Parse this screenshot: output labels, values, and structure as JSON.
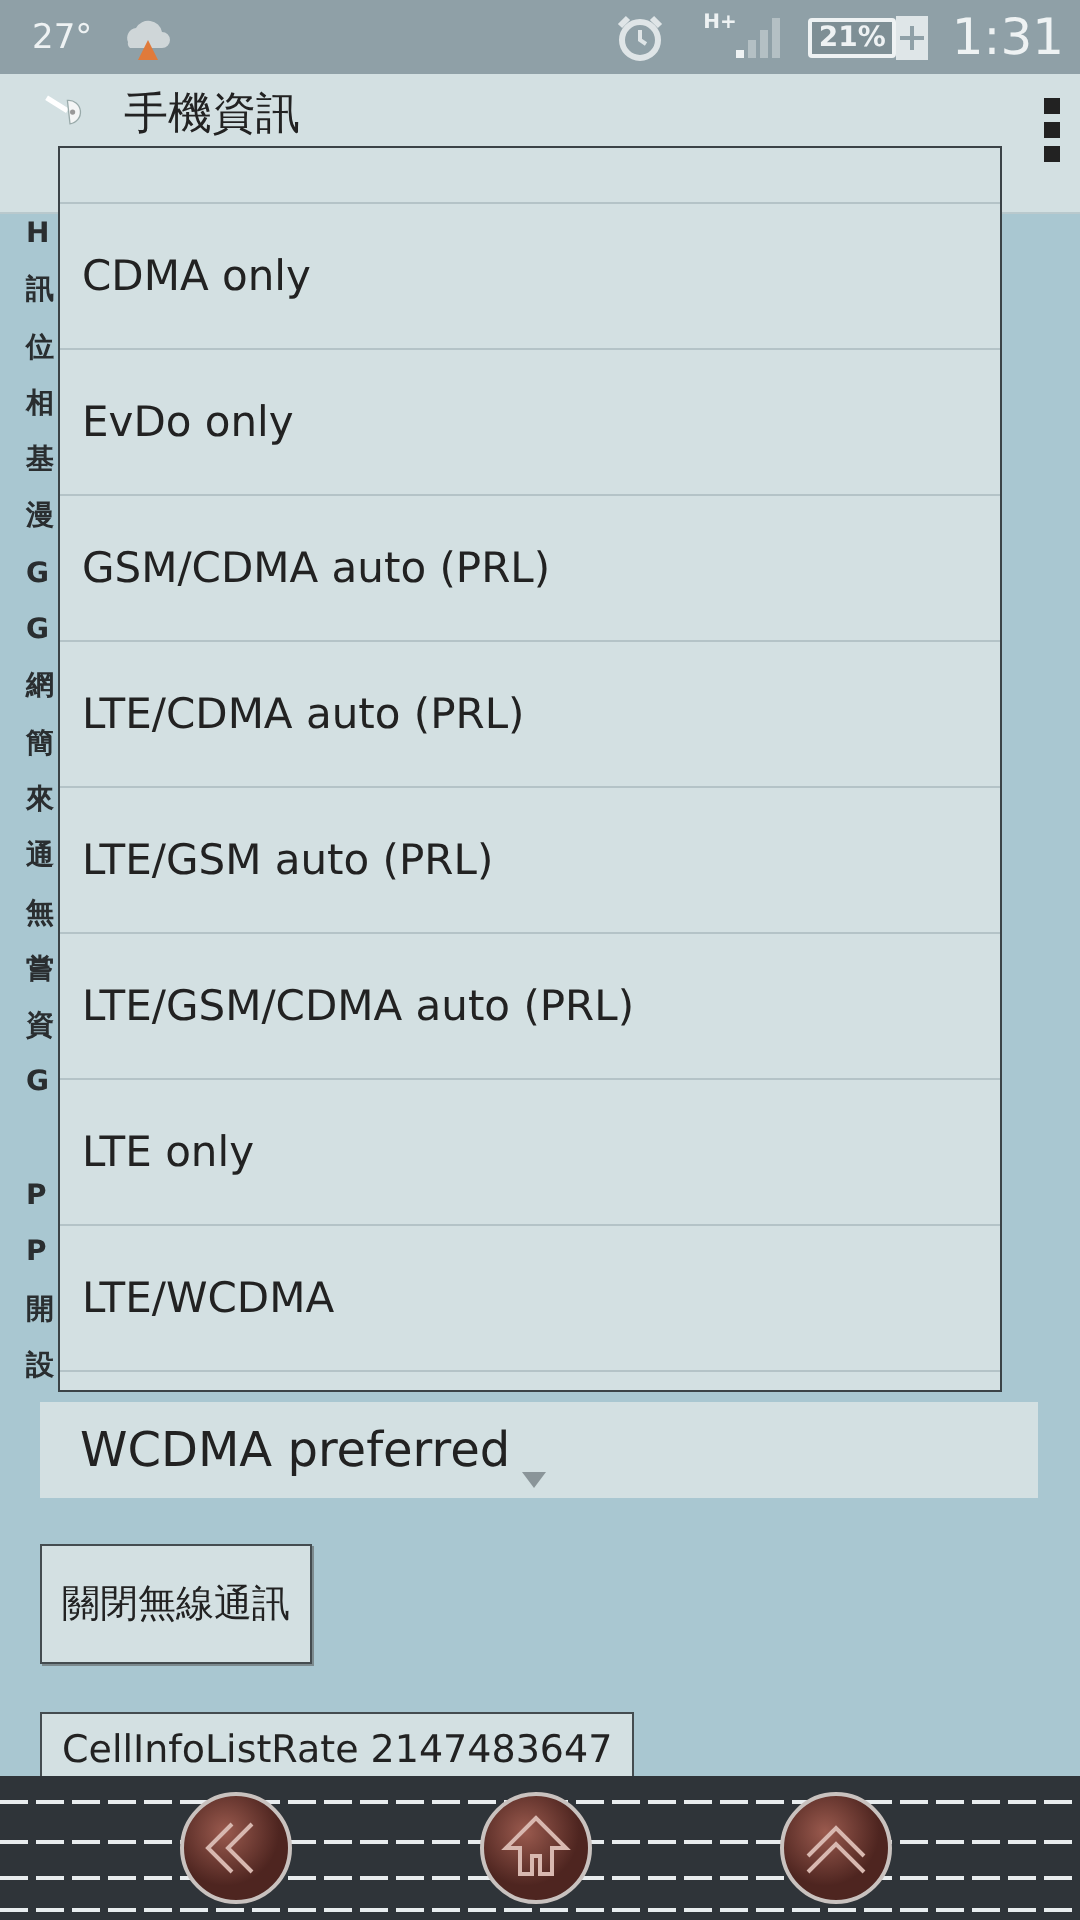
{
  "status_bar": {
    "temperature": "27°",
    "network_type": "H+",
    "battery": "21%",
    "time": "1:31"
  },
  "action_bar": {
    "title": "手機資訊"
  },
  "info_groups": [
    [
      "H",
      "訊",
      "位",
      "相",
      "基",
      "漫",
      "G",
      "G",
      "網",
      "簡",
      "來",
      "通",
      "無",
      "嘗",
      "資",
      "G"
    ],
    [
      "P",
      "P",
      "開",
      "設"
    ]
  ],
  "network_popup": {
    "items": [
      {
        "label": "CDMA only",
        "selected": false
      },
      {
        "label": "EvDo only",
        "selected": false
      },
      {
        "label": "GSM/CDMA auto (PRL)",
        "selected": false
      },
      {
        "label": "LTE/CDMA auto (PRL)",
        "selected": false
      },
      {
        "label": "LTE/GSM auto (PRL)",
        "selected": false
      },
      {
        "label": "LTE/GSM/CDMA auto (PRL)",
        "selected": false
      },
      {
        "label": "LTE only",
        "selected": false
      },
      {
        "label": "LTE/WCDMA",
        "selected": false
      }
    ]
  },
  "network_spinner": {
    "value": "WCDMA preferred"
  },
  "buttons": [
    "關閉無線通訊",
    "CellInfoListRate 2147483647"
  ]
}
